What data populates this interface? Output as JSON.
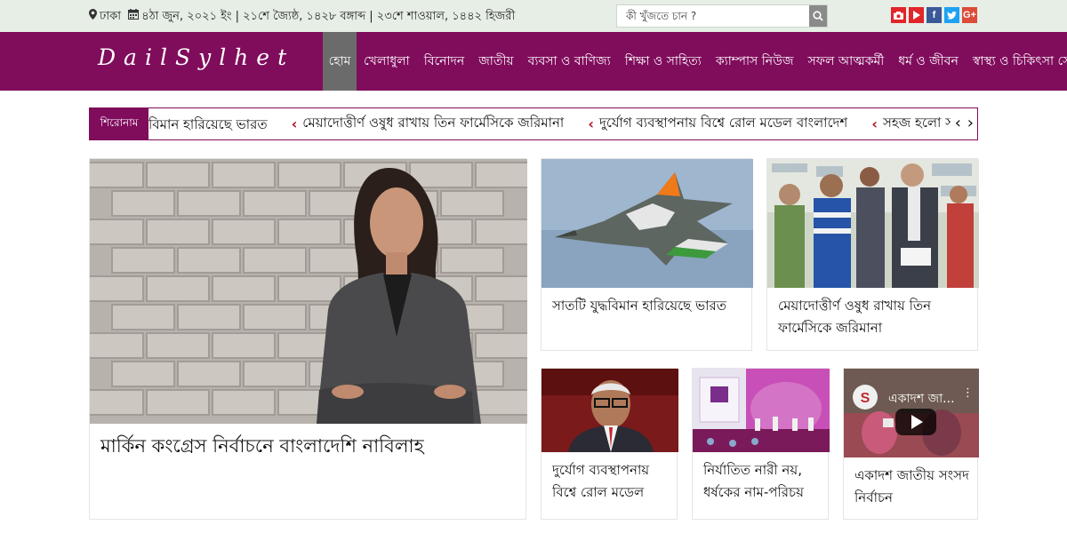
{
  "topbar": {
    "location": "ঢাকা",
    "date_text": "৪ঠা জুন, ২০২১ ইং | ২১শে জ্যৈষ্ঠ, ১৪২৮ বঙ্গাব্দ | ২৩শে শাওয়াল, ১৪৪২ হিজরী",
    "search_placeholder": "কী খুঁজতে চান ?",
    "social": [
      {
        "name": "youtube-icon",
        "color": "#e0262b"
      },
      {
        "name": "youtube-play-icon",
        "color": "#e0262b"
      },
      {
        "name": "facebook-icon",
        "color": "#3b5998"
      },
      {
        "name": "twitter-icon",
        "color": "#1da1f2"
      },
      {
        "name": "google-plus-icon",
        "color": "#dd4b39"
      }
    ]
  },
  "brand": {
    "logo": "DailSylhet",
    "primary_color": "#800c5c"
  },
  "nav": {
    "items": [
      "হোম",
      "খেলাধুলা",
      "বিনোদন",
      "জাতীয়",
      "ব্যবসা ও বাণিজ্য",
      "শিক্ষা ও সাহিত্য",
      "ক্যাম্পাস নিউজ",
      "সফল আত্মকর্মী",
      "ধর্ম ও জীবন",
      "স্বাস্থ্য ও চিকিৎসা সেবা"
    ]
  },
  "ticker": {
    "label": "শিরোনাম",
    "items": [
      "বিমান হারিয়েছে ভারত",
      "মেয়াদোত্তীর্ণ ওষুধ রাখায় তিন ফার্মেসিকে জরিমানা",
      "দুর্যোগ ব্যবস্থাপনায় বিশ্বে রোল মডেল বাংলাদেশ",
      "সহজ হলো সরকারি চাকরিজীবী"
    ]
  },
  "stories": {
    "hero": "মার্কিন কংগ্রেস নির্বাচনে বাংলাদেশি নাবিলাহ",
    "s1": "সাতটি যুদ্ধবিমান হারিয়েছে ভারত",
    "s2": "মেয়াদোত্তীর্ণ ওষুধ রাখায় তিন ফার্মেসিকে জরিমানা",
    "s3": "দুর্যোগ ব্যবস্থাপনায় বিশ্বে রোল মডেল",
    "s4": "নির্যাতিত নারী নয়, ধর্ষকের নাম-পরিচয়",
    "s5": "একাদশ জাতীয় সংসদ নির্বাচন",
    "video_overlay": "একাদশ জা..."
  }
}
